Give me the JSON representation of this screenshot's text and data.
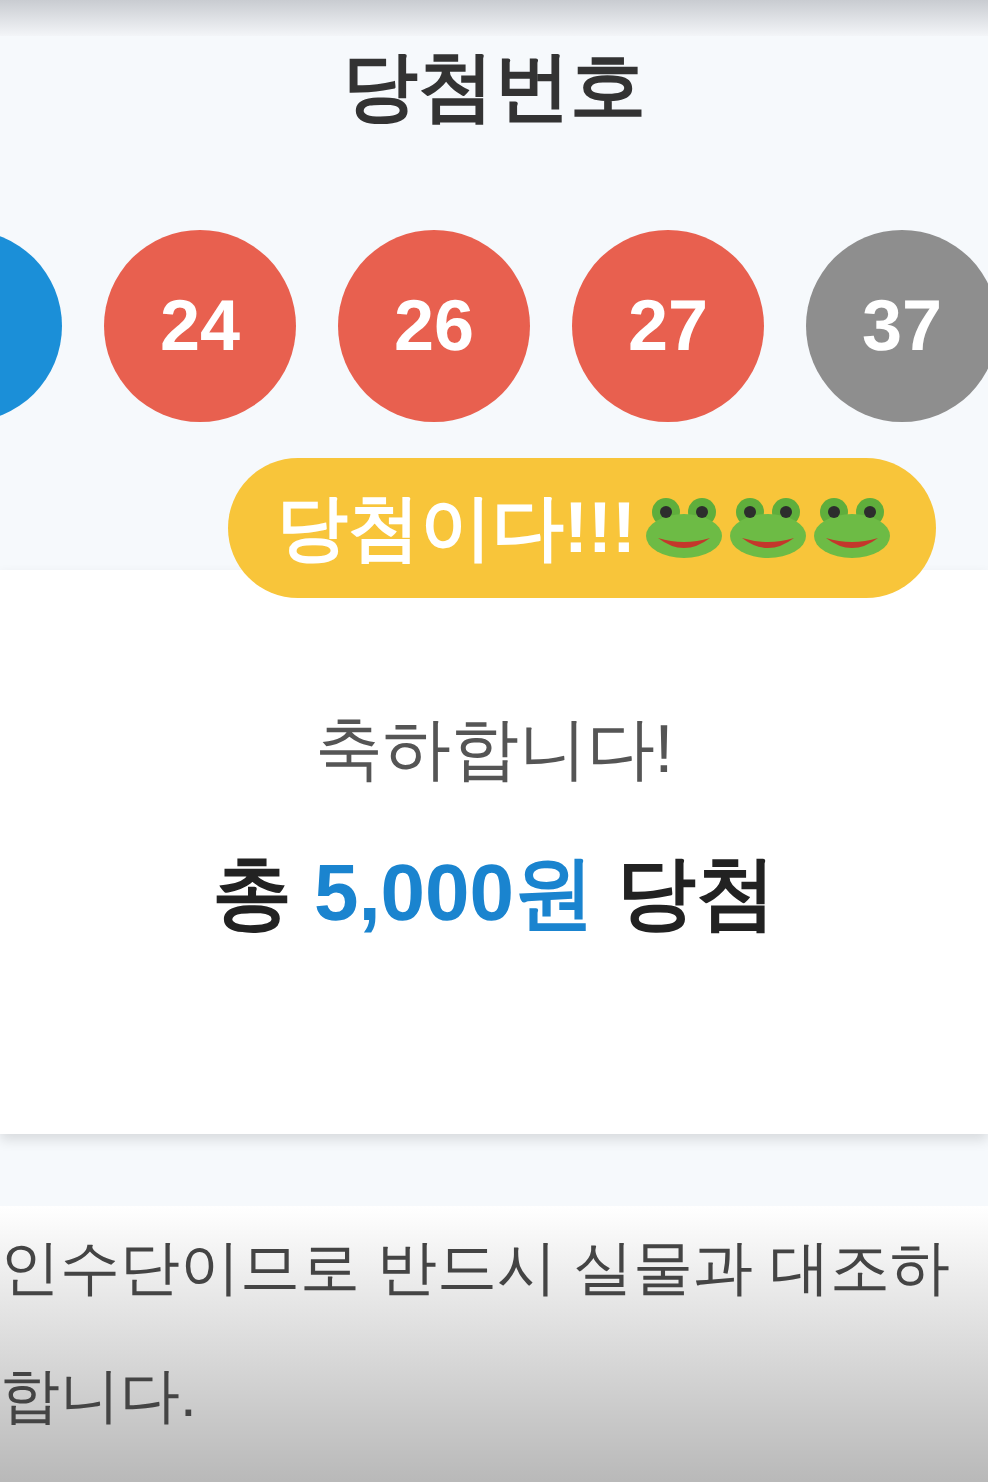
{
  "title": "당첨번호",
  "balls": [
    {
      "color": "#1b8fd8"
    },
    {
      "number": "24",
      "color": "#e8604f"
    },
    {
      "number": "26",
      "color": "#e8604f"
    },
    {
      "number": "27",
      "color": "#e8604f"
    },
    {
      "number": "37",
      "color": "#8e8e8e"
    }
  ],
  "badge": {
    "text": "당첨이다!!!"
  },
  "result": {
    "greeting": "축하합니다!",
    "prefix": "총",
    "amount": "5,000원",
    "suffix": "당첨"
  },
  "notice": [
    "인수단이므로 반드시 실물과 대조하",
    "합니다."
  ]
}
